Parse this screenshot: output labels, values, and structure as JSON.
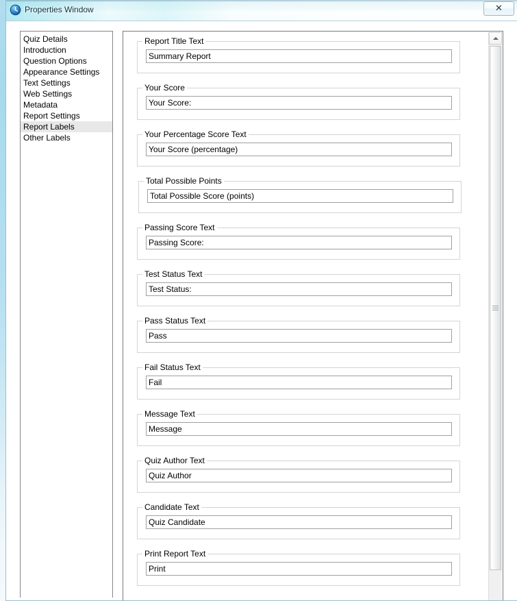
{
  "window": {
    "title": "Properties Window",
    "icon": "clock-icon",
    "close_label": "✕",
    "accent_color": "#7dd7e6",
    "border_color": "#9dbdd0"
  },
  "sidebar": {
    "selected": "Report Labels",
    "items": [
      {
        "label": "Quiz Details"
      },
      {
        "label": "Introduction"
      },
      {
        "label": "Question Options"
      },
      {
        "label": "Appearance Settings"
      },
      {
        "label": "Text Settings"
      },
      {
        "label": "Web Settings"
      },
      {
        "label": "Metadata"
      },
      {
        "label": "Report Settings"
      },
      {
        "label": "Report Labels"
      },
      {
        "label": "Other Labels"
      }
    ]
  },
  "panel": {
    "groups": [
      {
        "legend": "Report Title Text",
        "value": "Summary Report"
      },
      {
        "legend": "Your Score",
        "value": "Your Score:"
      },
      {
        "legend": "Your Percentage Score Text",
        "value": "Your Score (percentage)"
      },
      {
        "legend": "Total Possible Points",
        "value": "Total Possible Score (points)"
      },
      {
        "legend": "Passing Score Text",
        "value": "Passing Score:"
      },
      {
        "legend": "Test Status Text",
        "value": "Test Status:"
      },
      {
        "legend": "Pass Status Text",
        "value": "Pass"
      },
      {
        "legend": "Fail Status Text",
        "value": "Fail"
      },
      {
        "legend": "Message Text",
        "value": "Message"
      },
      {
        "legend": "Quiz Author Text",
        "value": "Quiz Author"
      },
      {
        "legend": "Candidate Text",
        "value": "Quiz Candidate"
      },
      {
        "legend": "Print Report Text",
        "value": "Print"
      }
    ]
  },
  "scrollbar": {
    "up_arrow": "triangle-up-icon",
    "thumb_grip": "grip-lines-icon"
  }
}
